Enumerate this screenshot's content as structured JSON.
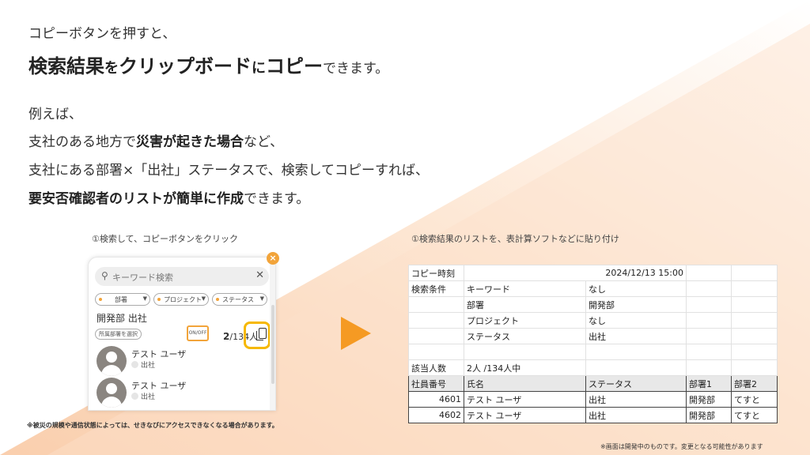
{
  "heading": {
    "line1": "コピーボタンを押すと、",
    "line2": {
      "p1": "検索結果",
      "p2": "を",
      "p3": "クリップボード",
      "p4": "に",
      "p5": "コピー",
      "p6": "できます。"
    },
    "line3": "例えば、",
    "line4": {
      "p1": "支社のある地方で",
      "p2": "災害が起きた場合",
      "p3": "など、"
    },
    "line5": "支社にある部署×「出社」ステータスで、検索してコピーすれば、",
    "line6": {
      "p1": "要安否確認者のリストが簡単に作成",
      "p2": "できます。"
    }
  },
  "captions": {
    "left": "①検索して、コピーボタンをクリック",
    "right": "①検索結果のリストを、表計算ソフトなどに貼り付け"
  },
  "phone": {
    "close": "×",
    "search_placeholder": "キーワード検索",
    "search_clear": "✕",
    "chips": [
      {
        "label": "部署",
        "arrow": "▼"
      },
      {
        "label": "プロジェクト",
        "arrow": "▼"
      },
      {
        "label": "ステータス",
        "arrow": "▼"
      }
    ],
    "dept_title": "開発部 出社",
    "select_dept": "所属部署を選択",
    "onoff": "ON/OFF",
    "count_num": "2",
    "count_rest": "/134人",
    "users": [
      {
        "name": "テスト ユーザ",
        "status": "出社"
      },
      {
        "name": "テスト ユーザ",
        "status": "出社"
      }
    ]
  },
  "sheet": {
    "rows": [
      [
        "コピー時刻",
        "",
        "2024/12/13 15:00",
        "",
        ""
      ],
      [
        "検索条件",
        "キーワード",
        "なし",
        "",
        ""
      ],
      [
        "",
        "部署",
        "開発部",
        "",
        ""
      ],
      [
        "",
        "プロジェクト",
        "なし",
        "",
        ""
      ],
      [
        "",
        "ステータス",
        "出社",
        "",
        ""
      ],
      [
        "",
        "",
        "",
        "",
        ""
      ],
      [
        "該当人数",
        "2人 /134人中",
        "",
        "",
        ""
      ]
    ],
    "header": [
      "社員番号",
      "氏名",
      "ステータス",
      "部署1",
      "部署2"
    ],
    "data": [
      [
        "4601",
        "テスト ユーザ",
        "出社",
        "開発部",
        "てすと"
      ],
      [
        "4602",
        "テスト ユーザ",
        "出社",
        "開発部",
        "てすと"
      ]
    ]
  },
  "notes": {
    "left": "※被災の規模や通信状態によっては、せきなびにアクセスできなくなる場合があります。",
    "right": "※画面は開発中のものです。変更となる可能性があります"
  },
  "colors": {
    "accent": "#f59a23",
    "highlight": "#f6b800",
    "peach": "#fbd9bf"
  }
}
